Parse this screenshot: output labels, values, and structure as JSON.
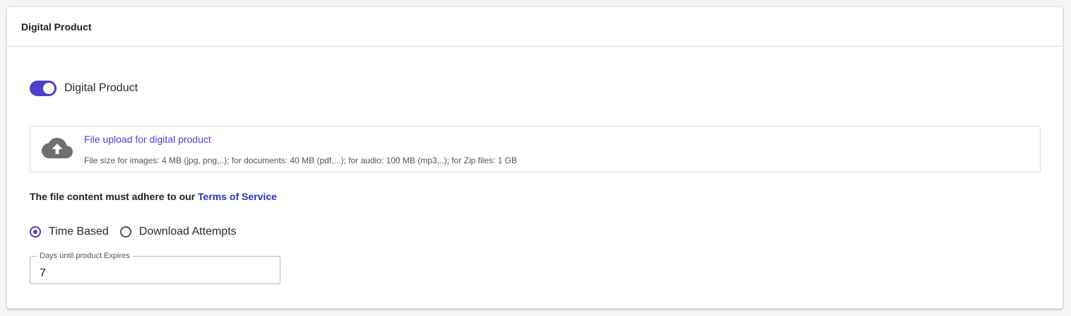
{
  "card": {
    "title": "Digital Product"
  },
  "toggle": {
    "label": "Digital Product",
    "checked": true,
    "accent_color": "#4f3fc9"
  },
  "upload": {
    "icon": "cloud-upload-icon",
    "title": "File upload for digital product",
    "hint": "File size for images: 4 MB (jpg, png,..); for documents: 40 MB (pdf,...); for audio: 100 MB (mp3,..); for Zip files: 1 GB"
  },
  "terms": {
    "prefix": "The file content must adhere to our",
    "link_text": "Terms of Service"
  },
  "expiry_mode": {
    "options": [
      {
        "label": "Time Based",
        "checked": true
      },
      {
        "label": "Download Attempts",
        "checked": false
      }
    ]
  },
  "days_field": {
    "label": "Days until product Expires",
    "value": "7"
  }
}
